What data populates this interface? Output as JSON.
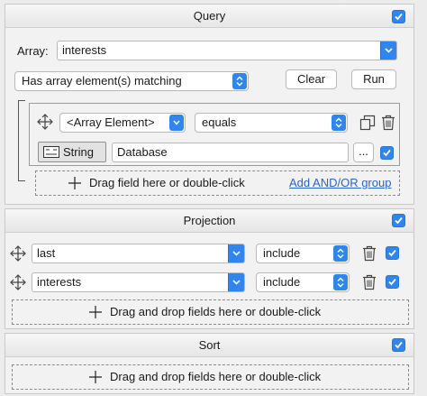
{
  "query": {
    "title": "Query",
    "enabled": true,
    "array_label": "Array:",
    "array_value": "interests",
    "match_mode": "Has array element(s) matching",
    "clear_label": "Clear",
    "run_label": "Run",
    "condition": {
      "field": "<Array Element>",
      "operator": "equals",
      "type_label": "String",
      "value": "Database",
      "more_label": "...",
      "enabled": true
    },
    "drop_label": "Drag field here or double-click",
    "add_group_label": "Add AND/OR group"
  },
  "projection": {
    "title": "Projection",
    "enabled": true,
    "rows": [
      {
        "field": "last",
        "mode": "include",
        "enabled": true
      },
      {
        "field": "interests",
        "mode": "include",
        "enabled": true
      }
    ],
    "drop_label": "Drag and drop fields here or double-click"
  },
  "sort": {
    "title": "Sort",
    "enabled": true,
    "drop_label": "Drag and drop fields here or double-click"
  },
  "colors": {
    "accent": "#2f86ee",
    "link": "#2a63c9",
    "panel_bg": "#f2f2f2"
  }
}
